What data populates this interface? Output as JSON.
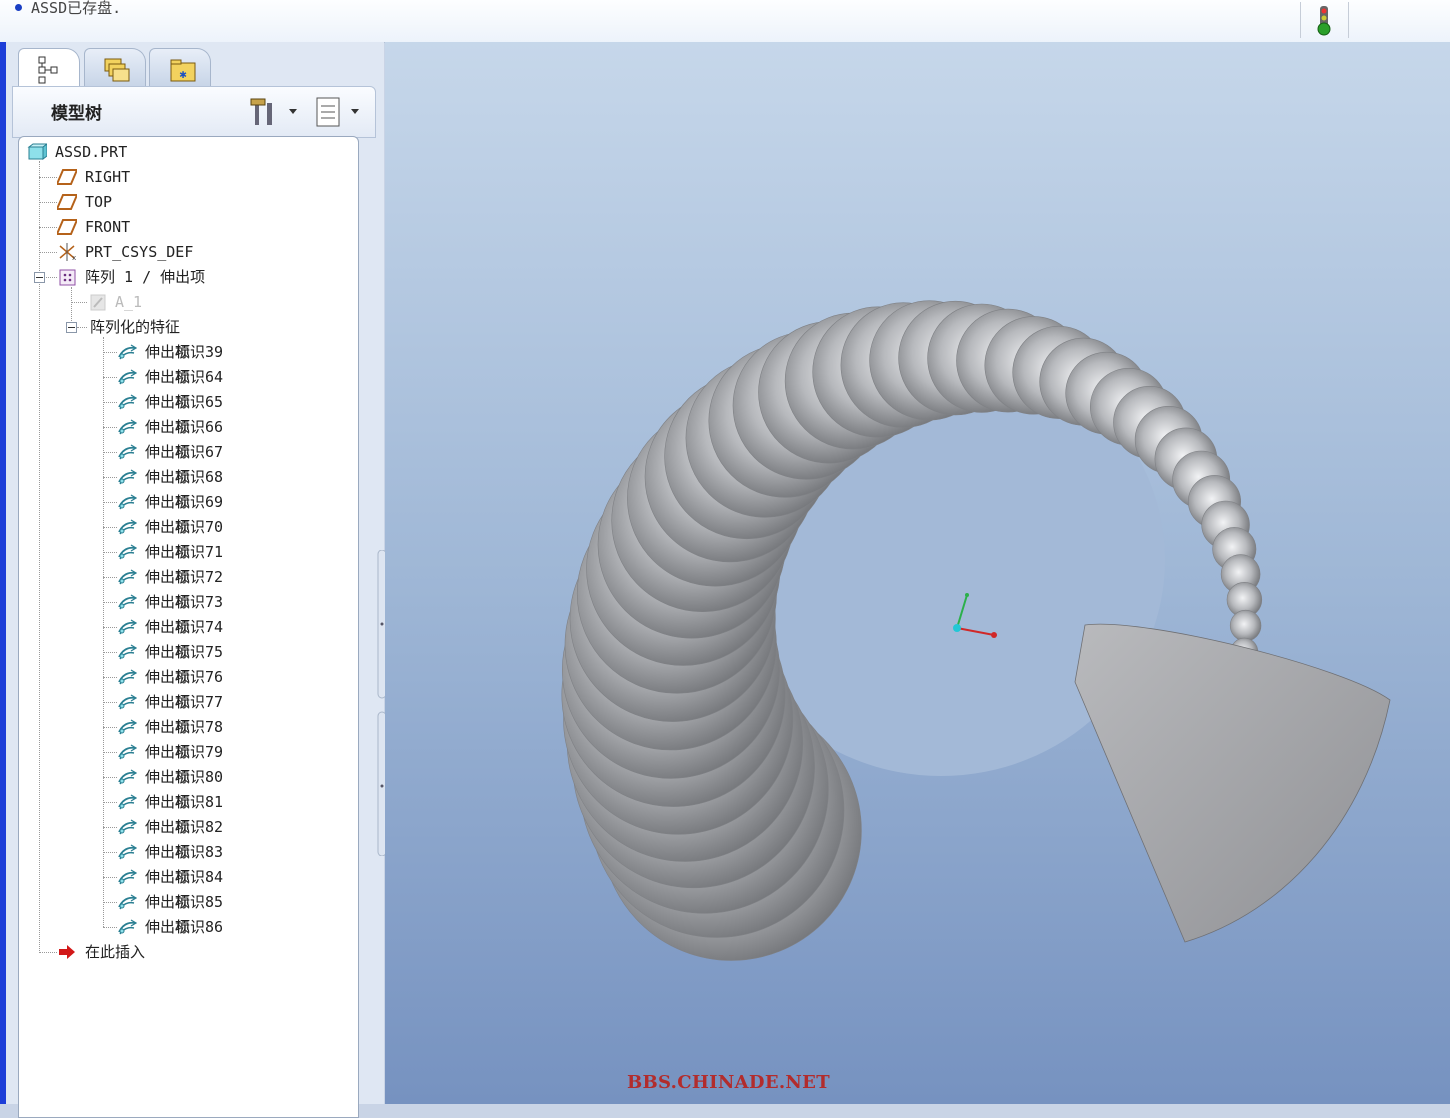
{
  "status_bar": {
    "message": "ASSD已存盘."
  },
  "panel": {
    "tabs": [
      {
        "name": "model-tree",
        "icon": "model-tree-icon"
      },
      {
        "name": "folder-browser",
        "icon": "folders-icon"
      },
      {
        "name": "favorites",
        "icon": "favorites-folder-icon"
      }
    ],
    "title": "模型树"
  },
  "tree": {
    "root": "ASSD.PRT",
    "datums": [
      "RIGHT",
      "TOP",
      "FRONT",
      "PRT_CSYS_DEF"
    ],
    "pattern_label": "阵列 1 / 伸出项",
    "pattern_child": "A_1",
    "group_label": "阵列化的特征",
    "feature_prefix": "伸出项",
    "features": [
      "标识39",
      "标识64",
      "标识65",
      "标识66",
      "标识67",
      "标识68",
      "标识69",
      "标识70",
      "标识71",
      "标识72",
      "标识73",
      "标识74",
      "标识75",
      "标识76",
      "标识77",
      "标识78",
      "标识79",
      "标识80",
      "标识81",
      "标识82",
      "标识83",
      "标识84",
      "标识85",
      "标识86"
    ],
    "insert_here": "在此插入"
  },
  "watermark": "BBS.CHINADE.NET",
  "colors": {
    "viewport_top": "#c6d7ea",
    "viewport_bottom": "#7692c0",
    "model": "#a9a9a9"
  }
}
